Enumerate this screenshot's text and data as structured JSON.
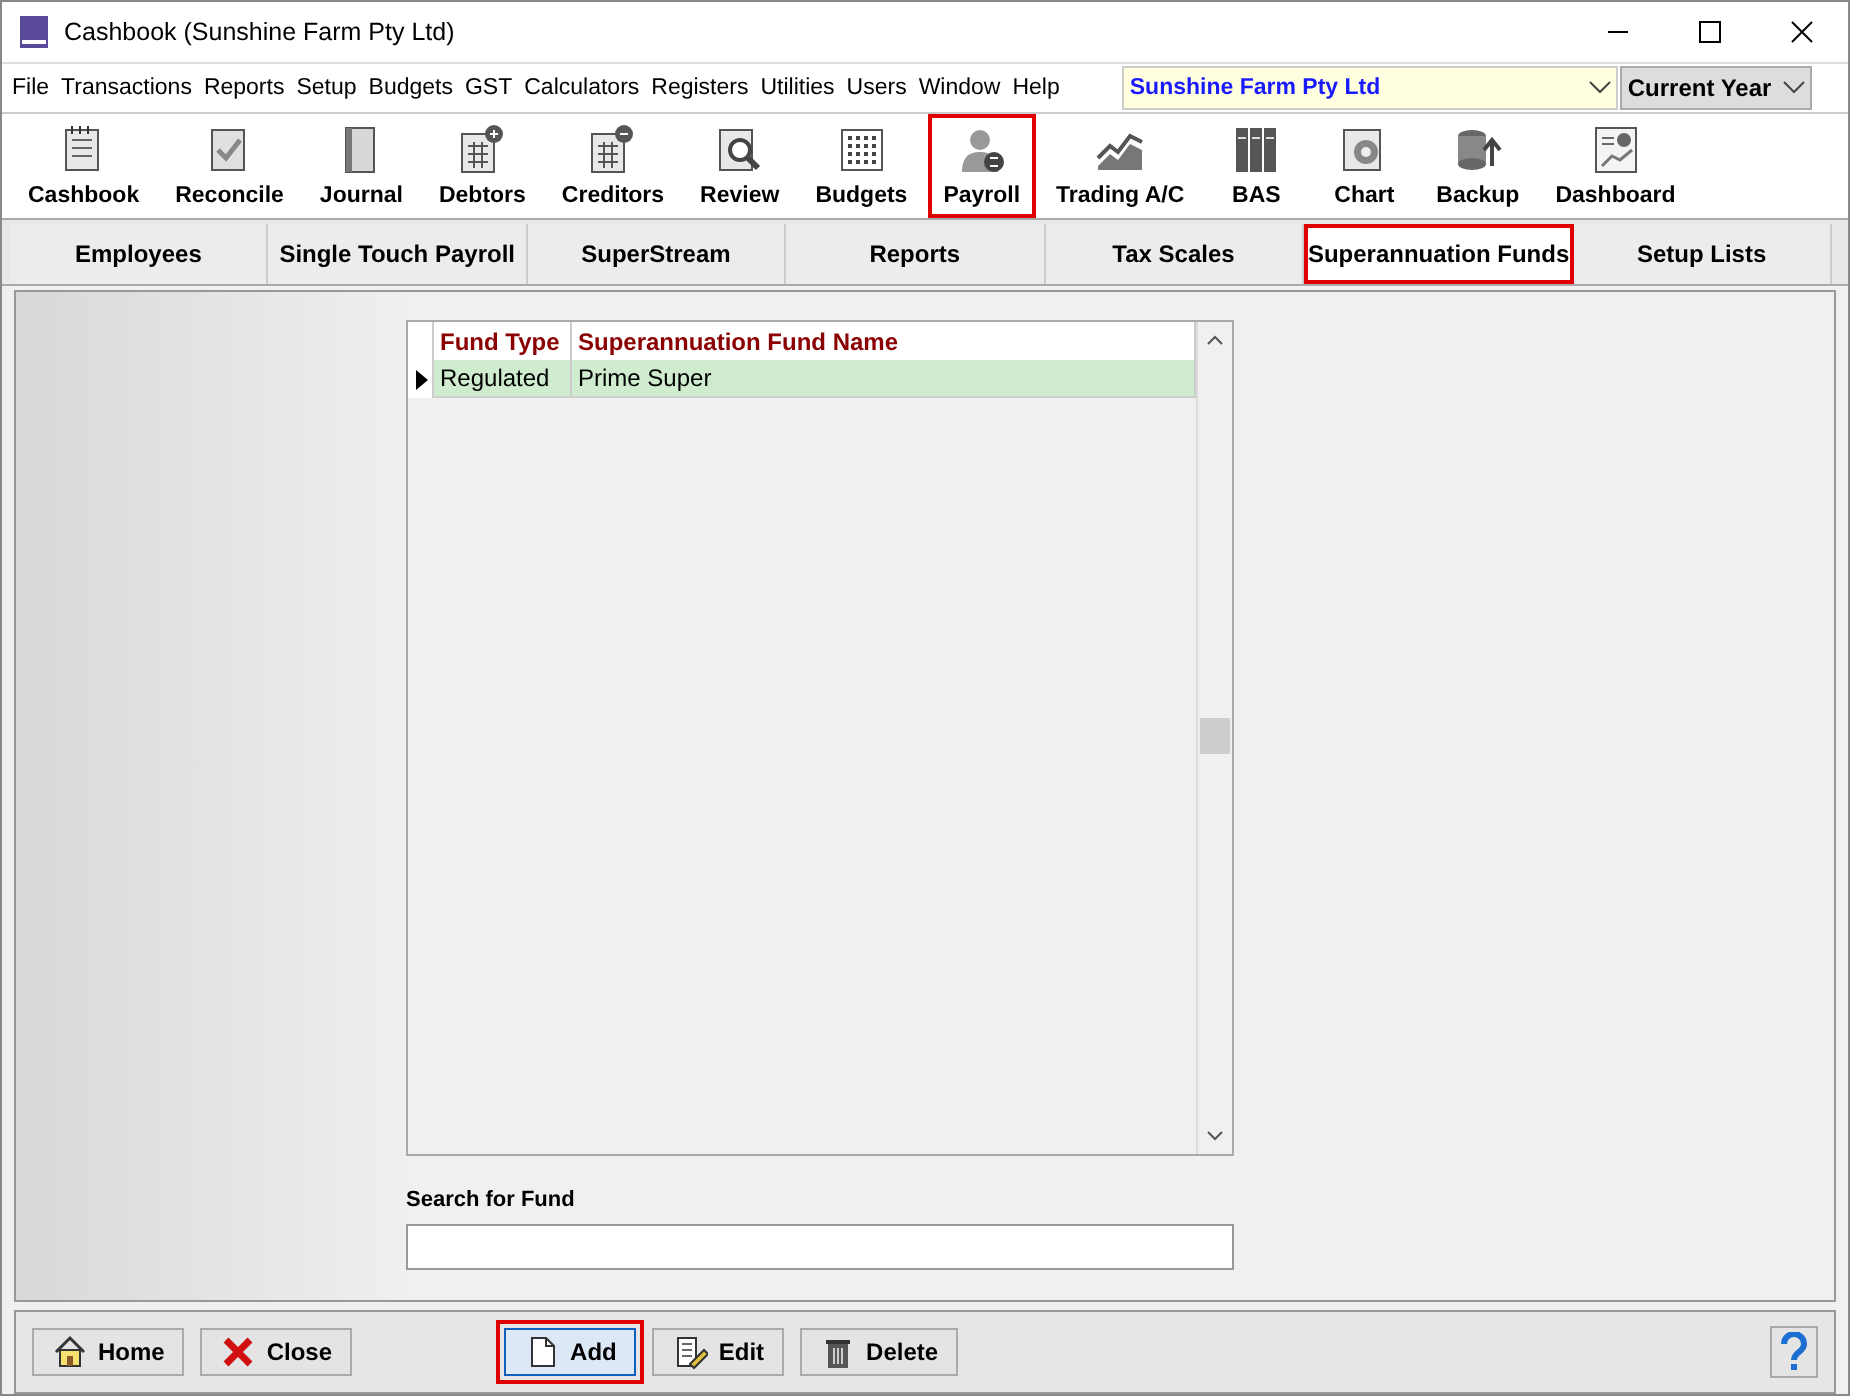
{
  "window": {
    "title": "Cashbook (Sunshine Farm Pty Ltd)"
  },
  "menu": [
    "File",
    "Transactions",
    "Reports",
    "Setup",
    "Budgets",
    "GST",
    "Calculators",
    "Registers",
    "Utilities",
    "Users",
    "Window",
    "Help"
  ],
  "company_select": {
    "value": "Sunshine Farm Pty Ltd"
  },
  "year_select": {
    "value": "Current Year"
  },
  "toolbar": [
    {
      "label": "Cashbook",
      "highlighted": false
    },
    {
      "label": "Reconcile",
      "highlighted": false
    },
    {
      "label": "Journal",
      "highlighted": false
    },
    {
      "label": "Debtors",
      "highlighted": false
    },
    {
      "label": "Creditors",
      "highlighted": false
    },
    {
      "label": "Review",
      "highlighted": false
    },
    {
      "label": "Budgets",
      "highlighted": false
    },
    {
      "label": "Payroll",
      "highlighted": true
    },
    {
      "label": "Trading A/C",
      "highlighted": false
    },
    {
      "label": "BAS",
      "highlighted": false
    },
    {
      "label": "Chart",
      "highlighted": false
    },
    {
      "label": "Backup",
      "highlighted": false
    },
    {
      "label": "Dashboard",
      "highlighted": false
    }
  ],
  "tabs": [
    {
      "label": "Employees",
      "selected": false,
      "highlighted": false
    },
    {
      "label": "Single Touch Payroll",
      "selected": false,
      "highlighted": false
    },
    {
      "label": "SuperStream",
      "selected": false,
      "highlighted": false
    },
    {
      "label": "Reports",
      "selected": false,
      "highlighted": false
    },
    {
      "label": "Tax Scales",
      "selected": false,
      "highlighted": false
    },
    {
      "label": "Superannuation Funds",
      "selected": true,
      "highlighted": true
    },
    {
      "label": "Setup Lists",
      "selected": false,
      "highlighted": false
    }
  ],
  "grid": {
    "columns": [
      "Fund Type",
      "Superannuation Fund Name"
    ],
    "rows": [
      {
        "cells": [
          "Regulated",
          "Prime Super"
        ],
        "selected": true
      }
    ]
  },
  "search": {
    "label": "Search for Fund"
  },
  "buttons": [
    {
      "label": "Home",
      "highlighted": false
    },
    {
      "label": "Close",
      "highlighted": false
    },
    {
      "label": "Add",
      "highlighted": true
    },
    {
      "label": "Edit",
      "highlighted": false
    },
    {
      "label": "Delete",
      "highlighted": false
    }
  ]
}
